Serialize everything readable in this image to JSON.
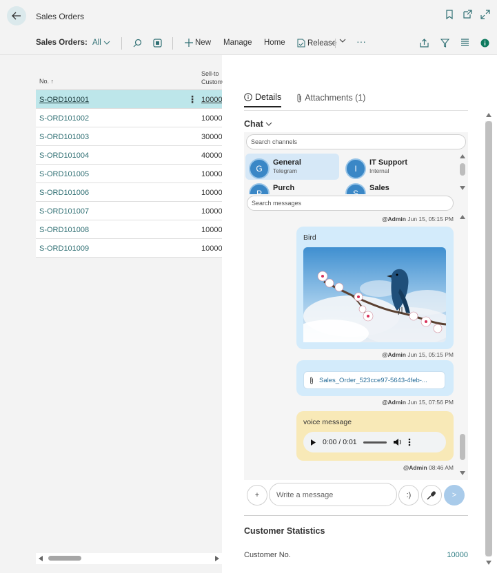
{
  "title_bar": {
    "title": "Sales Orders",
    "icons": [
      "arrow-left-icon",
      "bookmark-icon",
      "open-new-window-icon",
      "expand-icon"
    ]
  },
  "action_bar": {
    "page_label": "Sales Orders:",
    "filter_value": "All",
    "new_label": "New",
    "manage_label": "Manage",
    "home_label": "Home",
    "release_label": "Release",
    "more_label": "···"
  },
  "list": {
    "col_no": "No. ↑",
    "col_sell_line1": "Sell-to",
    "col_sell_line2": "Custom",
    "rows": [
      {
        "no": "S-ORD101001",
        "cust": "10000",
        "selected": true
      },
      {
        "no": "S-ORD101002",
        "cust": "10000"
      },
      {
        "no": "S-ORD101003",
        "cust": "30000"
      },
      {
        "no": "S-ORD101004",
        "cust": "40000"
      },
      {
        "no": "S-ORD101005",
        "cust": "10000"
      },
      {
        "no": "S-ORD101006",
        "cust": "10000"
      },
      {
        "no": "S-ORD101007",
        "cust": "10000"
      },
      {
        "no": "S-ORD101008",
        "cust": "10000"
      },
      {
        "no": "S-ORD101009",
        "cust": "10000"
      }
    ]
  },
  "panel": {
    "tab_details": "Details",
    "tab_attachments": "Attachments (1)",
    "chat_heading": "Chat",
    "search_channels_placeholder": "Search channels",
    "search_messages_placeholder": "Search messages",
    "channels": [
      {
        "initial": "G",
        "name": "General",
        "sub": "Telegram"
      },
      {
        "initial": "I",
        "name": "IT Support",
        "sub": "Internal"
      },
      {
        "initial": "P",
        "name": "Purch",
        "sub": ""
      },
      {
        "initial": "S",
        "name": "Sales",
        "sub": ""
      }
    ],
    "messages": [
      {
        "author": "@Admin",
        "time": "Jun 15, 05:15 PM"
      },
      {
        "text": "Bird",
        "author": "@Admin",
        "time": "Jun 15, 05:15 PM"
      },
      {
        "file": "Sales_Order_523cce97-5643-4feb-...",
        "author": "@Admin",
        "time": "Jun 15, 07:56 PM"
      },
      {
        "text": "voice message",
        "audio_time": "0:00 / 0:01",
        "author": "@Admin",
        "time": "08:46 AM"
      }
    ],
    "compose_placeholder": "Write a message",
    "add_label": "+",
    "emoji_label": ":)",
    "send_label": ">",
    "stats_title": "Customer Statistics",
    "stats_label": "Customer No.",
    "stats_value": "10000"
  },
  "colors": {
    "selected_row": "#bde6ea",
    "link": "#2f6f73",
    "bubble_blue": "#d3ebfb",
    "bubble_yellow": "#f8e9b7",
    "avatar": "#3a87c6"
  }
}
